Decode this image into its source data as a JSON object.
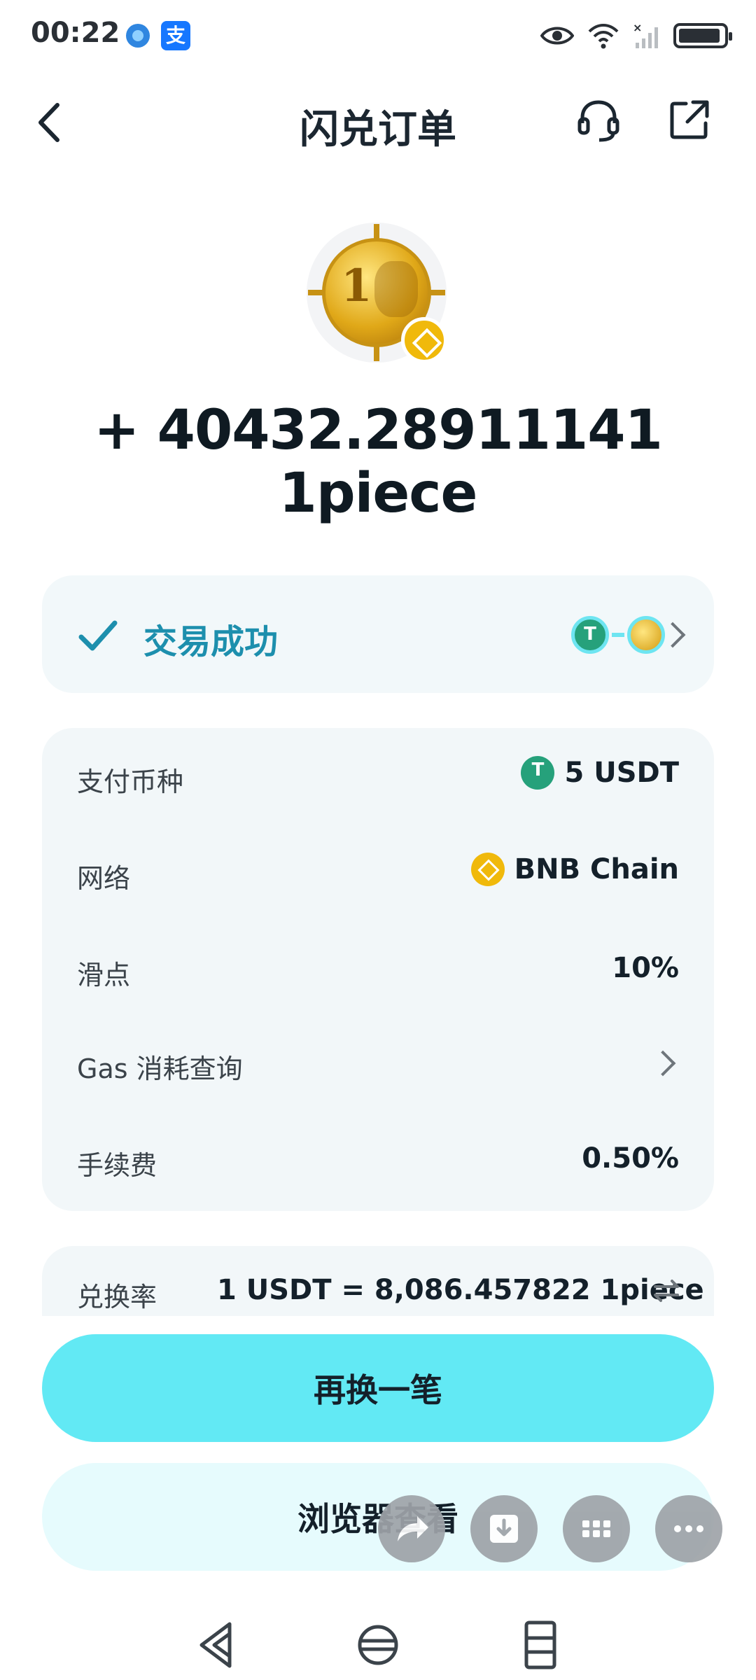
{
  "status_bar": {
    "time": "00:22",
    "app_icons": [
      "browser-icon",
      "alipay-icon"
    ],
    "alipay_glyph": "支",
    "right_icons": [
      "eye-icon",
      "wifi-icon",
      "signal-icon",
      "battery-icon"
    ]
  },
  "header": {
    "title": "闪兑订单",
    "back_icon": "back-arrow-icon",
    "support_icon": "headset-icon",
    "share_icon": "share-icon"
  },
  "token": {
    "amount": "+ 40432.28911141 1piece",
    "coin_numeral": "1",
    "badge": "bnb-icon"
  },
  "status": {
    "label": "交易成功",
    "icon": "check-icon",
    "pair": [
      "usdt-icon",
      "1piece-icon"
    ]
  },
  "details": {
    "rows": [
      {
        "label": "支付币种",
        "value": "5 USDT",
        "icon": "usdt-icon"
      },
      {
        "label": "网络",
        "value": "BNB Chain",
        "icon": "bnb-icon"
      },
      {
        "label": "滑点",
        "value": "10%"
      },
      {
        "label": "Gas 消耗查询",
        "value": ""
      },
      {
        "label": "手续费",
        "value": "0.50%"
      }
    ]
  },
  "rate": {
    "label": "兑换率",
    "value": "1 USDT = 8,086.457822 1piece"
  },
  "buttons": {
    "primary": "再换一笔",
    "secondary": "浏览器查看"
  },
  "colors": {
    "accent": "#62e9f4",
    "success_text": "#1d8fad",
    "card_bg": "#f2f7f9",
    "usdt": "#26a17b",
    "bnb": "#f0b90b"
  }
}
